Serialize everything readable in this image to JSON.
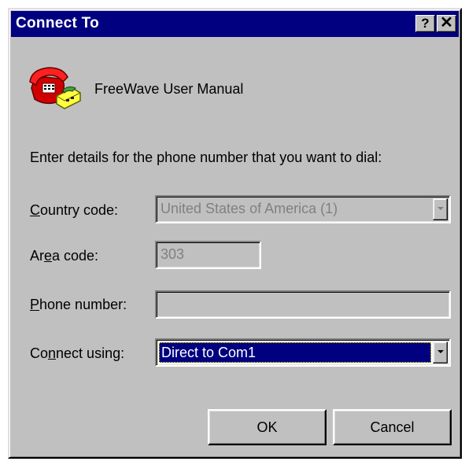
{
  "window": {
    "title": "Connect To",
    "help_label": "?",
    "close_label": "✕"
  },
  "connection": {
    "name": "FreeWave User Manual",
    "icon": "phone-icon"
  },
  "instructions": "Enter details for the phone number that you want to dial:",
  "fields": {
    "country_code": {
      "label_mnemonic": "C",
      "label_rest": "ountry code:",
      "value": "United States of America (1)",
      "enabled": false
    },
    "area_code": {
      "label_pre": "Ar",
      "label_mnemonic": "e",
      "label_post": "a code:",
      "value": "303",
      "enabled": false
    },
    "phone_number": {
      "label_mnemonic": "P",
      "label_rest": "hone number:",
      "value": "",
      "enabled": false
    },
    "connect_using": {
      "label_pre": "Co",
      "label_mnemonic": "n",
      "label_post": "nect using:",
      "value": "Direct to Com1",
      "enabled": true
    }
  },
  "buttons": {
    "ok": "OK",
    "cancel": "Cancel"
  },
  "colors": {
    "titlebar": "#000080",
    "dialog_face": "#c0c0c0",
    "selection": "#000080"
  }
}
